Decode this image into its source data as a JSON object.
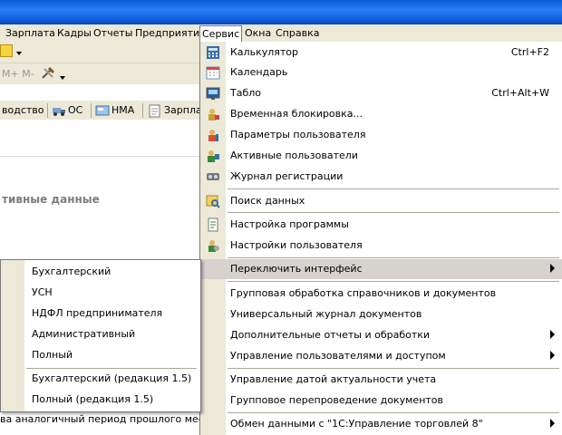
{
  "menubar": {
    "items": [
      "Зарплата",
      "Кадры",
      "Отчеты",
      "Предприятие",
      "Сервис",
      "Окна",
      "Справка"
    ],
    "active": "Сервис"
  },
  "toolbar": {
    "memory_label": "M+ M-"
  },
  "tabs": [
    "водство",
    "ОС",
    "НМА",
    "Зарплата"
  ],
  "section_title": "тивные данные",
  "lower_text": "ва аналогичный период прошлого месяца (п",
  "service_menu": {
    "items": [
      {
        "label": "Калькулятор",
        "shortcut": "Ctrl+F2",
        "icon": "calculator-icon"
      },
      {
        "label": "Календарь",
        "shortcut": "",
        "icon": "calendar-icon"
      },
      {
        "label": "Табло",
        "shortcut": "Ctrl+Alt+W",
        "icon": "scoreboard-icon"
      },
      {
        "label": "Временная блокировка...",
        "shortcut": "",
        "icon": "lock-user-icon"
      },
      {
        "label": "Параметры пользователя",
        "shortcut": "",
        "icon": "user-params-icon"
      },
      {
        "label": "Активные пользователи",
        "shortcut": "",
        "icon": "active-users-icon"
      },
      {
        "label": "Журнал регистрации",
        "shortcut": "",
        "icon": "log-icon"
      },
      {
        "label": "Поиск данных",
        "shortcut": "",
        "icon": "search-data-icon"
      },
      {
        "label": "Настройка программы",
        "shortcut": "",
        "icon": "program-settings-icon"
      },
      {
        "label": "Настройки пользователя",
        "shortcut": "",
        "icon": "user-settings-icon"
      },
      {
        "label": "Переключить интерфейс",
        "shortcut": "",
        "icon": ""
      },
      {
        "label": "Групповая обработка справочников и документов",
        "shortcut": "",
        "icon": ""
      },
      {
        "label": "Универсальный журнал документов",
        "shortcut": "",
        "icon": ""
      },
      {
        "label": "Дополнительные отчеты и обработки",
        "shortcut": "",
        "icon": ""
      },
      {
        "label": "Управление пользователями и доступом",
        "shortcut": "",
        "icon": ""
      },
      {
        "label": "Управление датой актуальности учета",
        "shortcut": "",
        "icon": ""
      },
      {
        "label": "Групповое перепроведение документов",
        "shortcut": "",
        "icon": ""
      },
      {
        "label": "Обмен данными с \"1С:Управление торговлей 8\"",
        "shortcut": "",
        "icon": ""
      }
    ]
  },
  "interface_submenu": {
    "items": [
      "Бухгалтерский",
      "УСН",
      "НДФЛ предпринимателя",
      "Административный",
      "Полный",
      "Бухгалтерский (редакция 1.5)",
      "Полный (редакция 1.5)"
    ]
  },
  "colors": {
    "titlebar": "#2a7cf3",
    "chrome": "#ece9d8",
    "highlight": "#d6d3ce"
  }
}
